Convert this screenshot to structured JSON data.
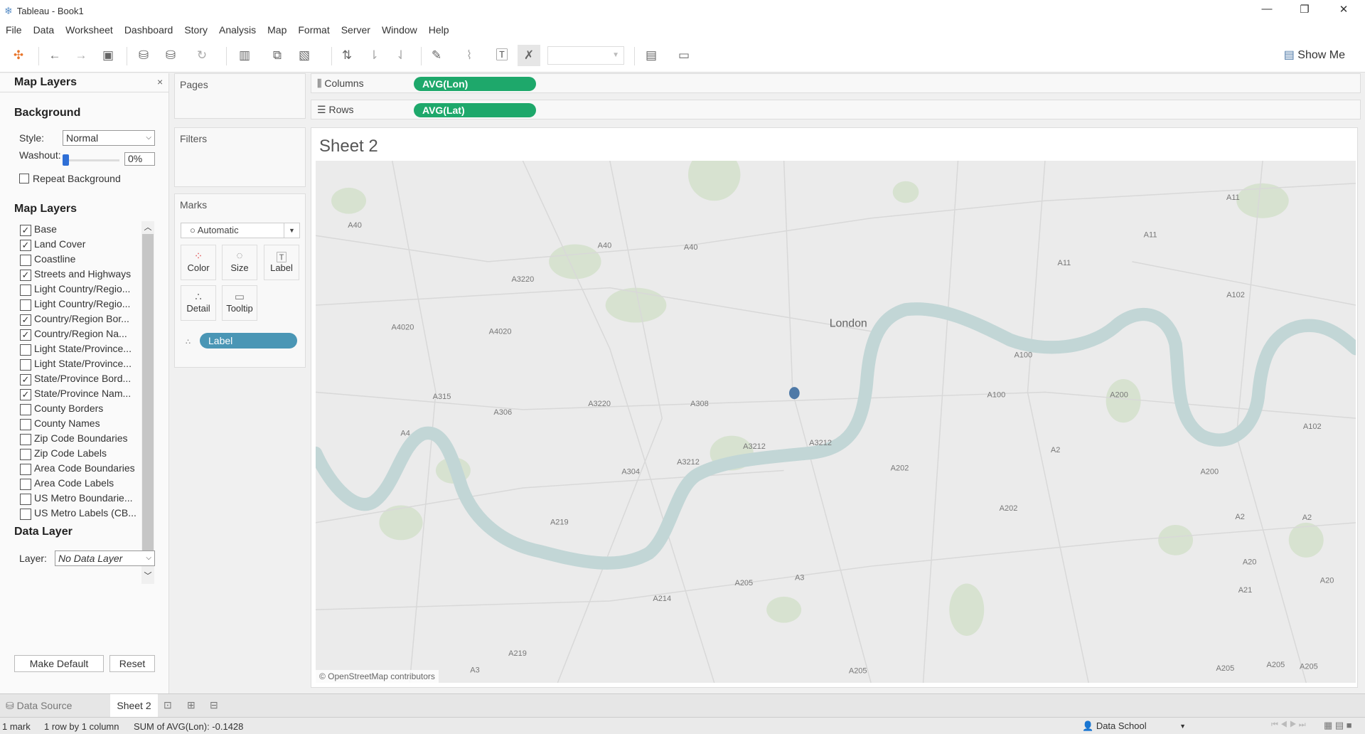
{
  "window": {
    "title": "Tableau - Book1"
  },
  "menu": [
    "File",
    "Data",
    "Worksheet",
    "Dashboard",
    "Story",
    "Analysis",
    "Map",
    "Format",
    "Server",
    "Window",
    "Help"
  ],
  "toolbar": {
    "show_me": "Show Me"
  },
  "map_layers_panel": {
    "title": "Map Layers",
    "background_heading": "Background",
    "style_label": "Style:",
    "style_value": "Normal",
    "washout_label": "Washout:",
    "washout_value": "0%",
    "washout_fraction": 0,
    "repeat_background": {
      "label": "Repeat Background",
      "checked": false
    },
    "layers_heading": "Map Layers",
    "layers": [
      {
        "label": "Base",
        "checked": true
      },
      {
        "label": "Land Cover",
        "checked": true
      },
      {
        "label": "Coastline",
        "checked": false
      },
      {
        "label": "Streets and Highways",
        "checked": true
      },
      {
        "label": "Light Country/Regio...",
        "checked": false
      },
      {
        "label": "Light Country/Regio...",
        "checked": false
      },
      {
        "label": "Country/Region Bor...",
        "checked": true
      },
      {
        "label": "Country/Region Na...",
        "checked": true
      },
      {
        "label": "Light State/Province...",
        "checked": false
      },
      {
        "label": "Light State/Province...",
        "checked": false
      },
      {
        "label": "State/Province Bord...",
        "checked": true
      },
      {
        "label": "State/Province Nam...",
        "checked": true
      },
      {
        "label": "County Borders",
        "checked": false
      },
      {
        "label": "County Names",
        "checked": false
      },
      {
        "label": "Zip Code Boundaries",
        "checked": false
      },
      {
        "label": "Zip Code Labels",
        "checked": false
      },
      {
        "label": "Area Code Boundaries",
        "checked": false
      },
      {
        "label": "Area Code Labels",
        "checked": false
      },
      {
        "label": "US Metro Boundarie...",
        "checked": false
      },
      {
        "label": "US Metro Labels (CB...",
        "checked": false
      }
    ],
    "data_layer_heading": "Data Layer",
    "layer_label": "Layer:",
    "layer_value": "No Data Layer",
    "make_default": "Make Default",
    "reset": "Reset"
  },
  "cards": {
    "pages": "Pages",
    "filters": "Filters",
    "marks": "Marks",
    "mark_type": "Automatic",
    "mark_buttons": [
      "Color",
      "Size",
      "Label",
      "Detail",
      "Tooltip"
    ],
    "label_pill": "Label"
  },
  "shelves": {
    "columns_label": "Columns",
    "columns_pill": "AVG(Lon)",
    "rows_label": "Rows",
    "rows_pill": "AVG(Lat)"
  },
  "sheet": {
    "title": "Sheet 2"
  },
  "map": {
    "place_label": "London",
    "attribution": "© OpenStreetMap contributors",
    "road_labels": [
      "A40",
      "A40",
      "A40",
      "A3220",
      "A4020",
      "A4020",
      "A315",
      "A306",
      "A3220",
      "A308",
      "A4",
      "A3212",
      "A3212",
      "A3212",
      "A304",
      "A219",
      "A11",
      "A11",
      "A11",
      "A102",
      "A100",
      "A100",
      "A200",
      "A102",
      "A2",
      "A202",
      "A200",
      "A202",
      "A2",
      "A2",
      "A20",
      "A21",
      "A20",
      "A205",
      "A3",
      "A214",
      "A219",
      "A3",
      "A205",
      "A205",
      "A205",
      "A205"
    ],
    "mark_color": "#4e79a7",
    "water_color": "#c2d6d6",
    "park_color": "#d7e2d0"
  },
  "tabs": {
    "data_source": "Data Source",
    "sheet": "Sheet 2"
  },
  "status": {
    "marks": "1 mark",
    "rows_cols": "1 row by 1 column",
    "sum": "SUM of AVG(Lon): -0.1428",
    "user": "Data School"
  }
}
